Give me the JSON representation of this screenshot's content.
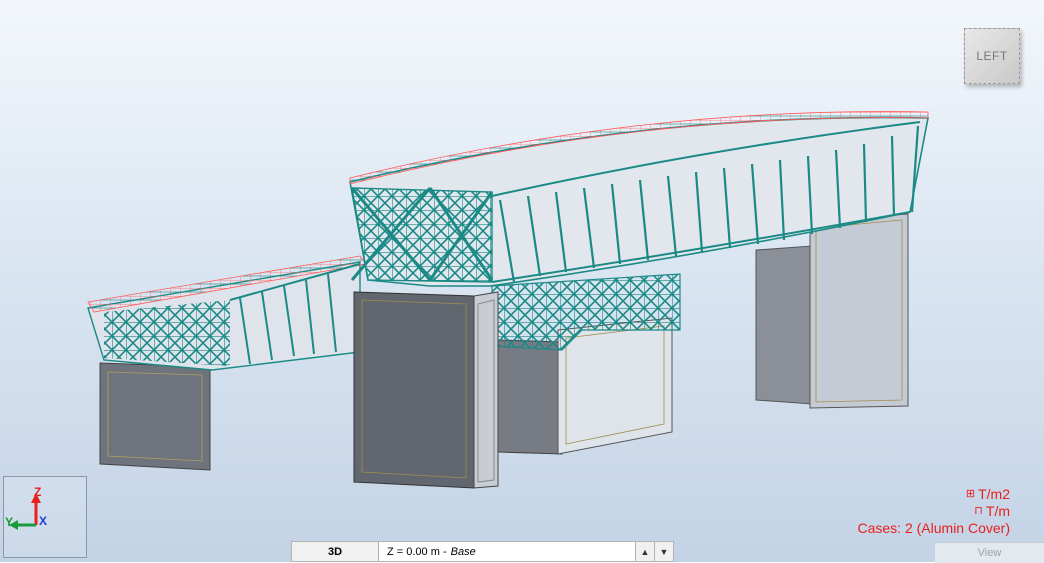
{
  "viewcube": {
    "face_label": "LEFT"
  },
  "axis_indicator": {
    "z_label": "Z",
    "y_label": "Y",
    "x_label": "X"
  },
  "legend": {
    "area_load_unit": "T/m2",
    "line_load_unit": "T/m",
    "cases_text": "Cases: 2 (Alumin Cover)",
    "color": "#e8201c"
  },
  "bottom_bar": {
    "view_mode": "3D",
    "level_prefix": "Z = 0.00 m - ",
    "level_name": "Base",
    "spin_up": "▲",
    "spin_down": "▼"
  },
  "view_tab": {
    "label": "View"
  },
  "colors": {
    "truss": "#1b8a86",
    "load": "#ff5a5a",
    "pier": "#707580",
    "cladding": "#dfe4ec"
  }
}
